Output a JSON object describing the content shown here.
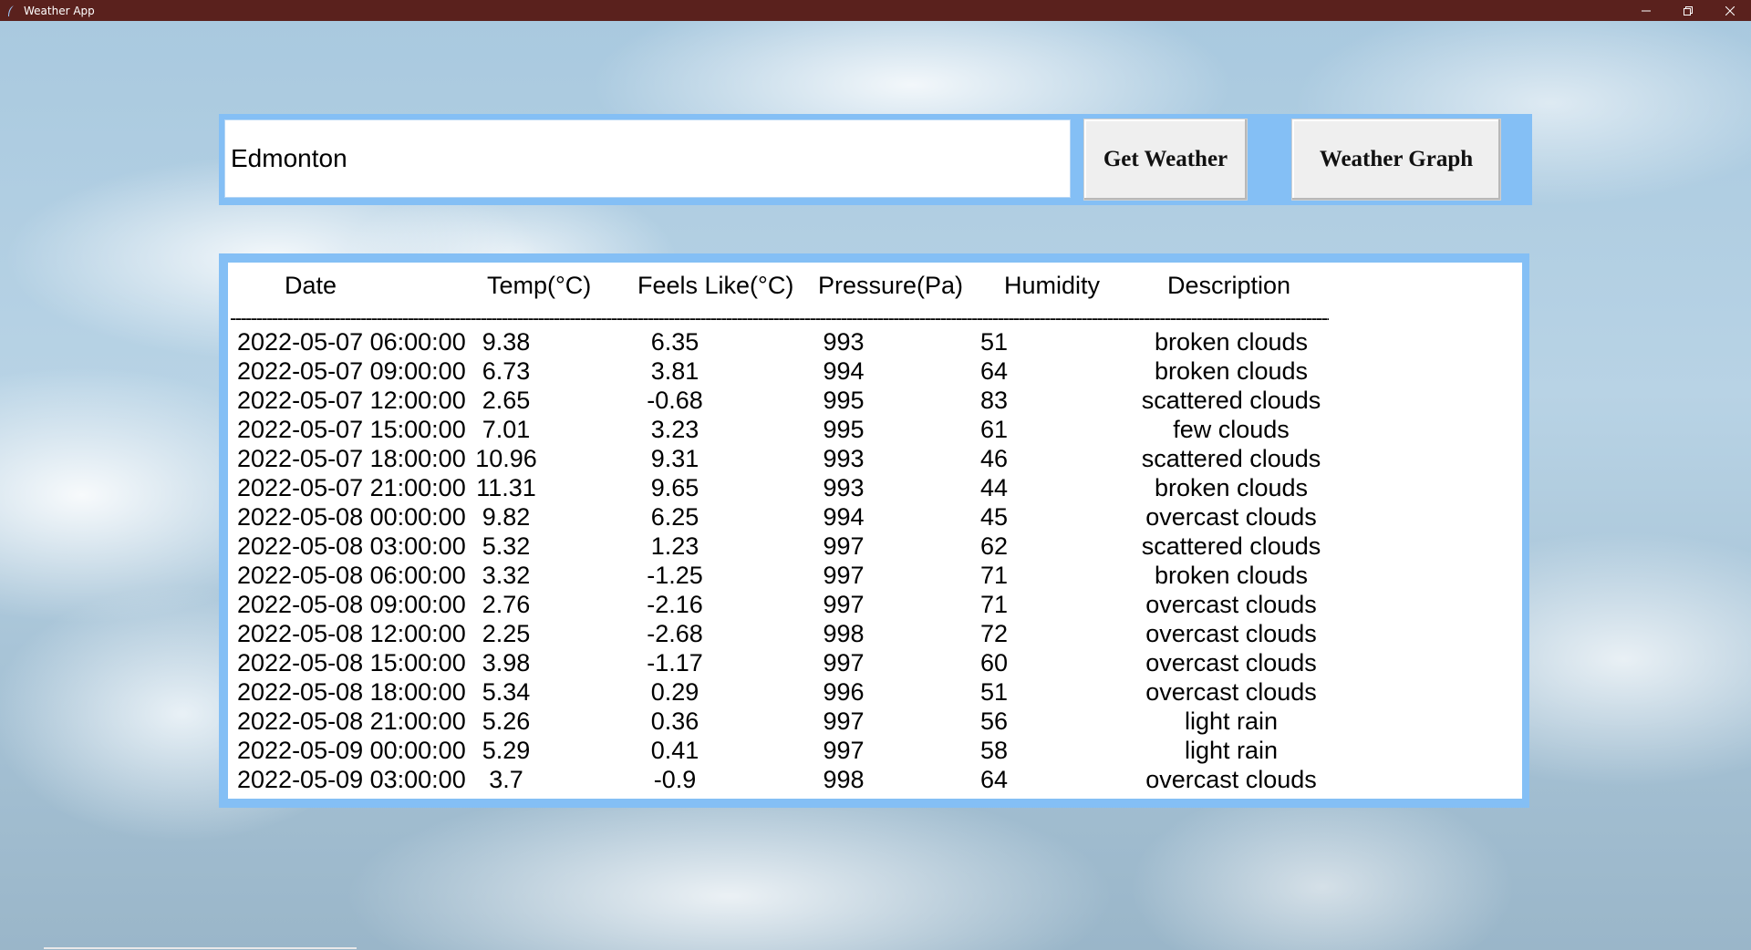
{
  "window": {
    "title": "Weather App",
    "icons": {
      "app": "feather-icon",
      "minimize": "minimize-icon",
      "restore": "restore-icon",
      "close": "close-icon"
    }
  },
  "search": {
    "value": "Edmonton",
    "get_label": "Get Weather",
    "graph_label": "Weather Graph"
  },
  "table": {
    "headers": [
      "Date",
      "Temp(°C)",
      "Feels Like(°C)",
      "Pressure(Pa)",
      "Humidity",
      "Description"
    ],
    "rule": "------------------------------------------------------------------------------------------------------------------------------------------------------------------------------------------------------------------------------------------",
    "rows": [
      [
        "2022-05-07 06:00:00",
        "9.38",
        "6.35",
        "993",
        "51",
        "broken clouds"
      ],
      [
        "2022-05-07 09:00:00",
        "6.73",
        "3.81",
        "994",
        "64",
        "broken clouds"
      ],
      [
        "2022-05-07 12:00:00",
        "2.65",
        "-0.68",
        "995",
        "83",
        "scattered clouds"
      ],
      [
        "2022-05-07 15:00:00",
        "7.01",
        "3.23",
        "995",
        "61",
        "few clouds"
      ],
      [
        "2022-05-07 18:00:00",
        "10.96",
        "9.31",
        "993",
        "46",
        "scattered clouds"
      ],
      [
        "2022-05-07 21:00:00",
        "11.31",
        "9.65",
        "993",
        "44",
        "broken clouds"
      ],
      [
        "2022-05-08 00:00:00",
        "9.82",
        "6.25",
        "994",
        "45",
        "overcast clouds"
      ],
      [
        "2022-05-08 03:00:00",
        "5.32",
        "1.23",
        "997",
        "62",
        "scattered clouds"
      ],
      [
        "2022-05-08 06:00:00",
        "3.32",
        "-1.25",
        "997",
        "71",
        "broken clouds"
      ],
      [
        "2022-05-08 09:00:00",
        "2.76",
        "-2.16",
        "997",
        "71",
        "overcast clouds"
      ],
      [
        "2022-05-08 12:00:00",
        "2.25",
        "-2.68",
        "998",
        "72",
        "overcast clouds"
      ],
      [
        "2022-05-08 15:00:00",
        "3.98",
        "-1.17",
        "997",
        "60",
        "overcast clouds"
      ],
      [
        "2022-05-08 18:00:00",
        "5.34",
        "0.29",
        "996",
        "51",
        "overcast clouds"
      ],
      [
        "2022-05-08 21:00:00",
        "5.26",
        "0.36",
        "997",
        "56",
        "light rain"
      ],
      [
        "2022-05-09 00:00:00",
        "5.29",
        "0.41",
        "997",
        "58",
        "light rain"
      ],
      [
        "2022-05-09 03:00:00",
        "3.7",
        "-0.9",
        "998",
        "64",
        "overcast clouds"
      ]
    ]
  },
  "colors": {
    "titlebar": "#5a211d",
    "frame": "#84bff5"
  }
}
